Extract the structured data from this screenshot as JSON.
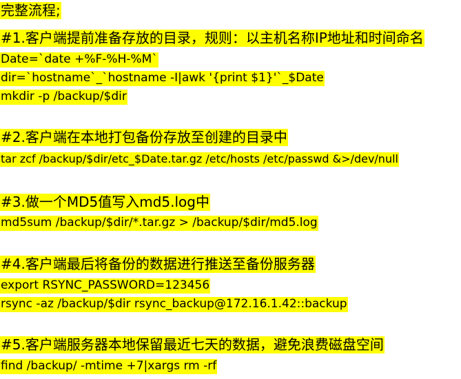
{
  "doc": {
    "title": "完整流程;",
    "sections": [
      {
        "heading": "#1.客户端提前准备存放的目录，规则：以主机名称IP地址和时间命名",
        "commands": [
          "Date=`date +%F-%H-%M`",
          "dir=`hostname`_`hostname -I|awk '{print $1}'`_$Date",
          "mkdir -p /backup/$dir"
        ]
      },
      {
        "heading": "#2.客户端在本地打包备份存放至创建的目录中",
        "commands": [
          "tar zcf /backup/$dir/etc_$Date.tar.gz /etc/hosts /etc/passwd &>/dev/null"
        ]
      },
      {
        "heading": "#3.做一个MD5值写入md5.log中",
        "commands": [
          "md5sum /backup/$dir/*.tar.gz > /backup/$dir/md5.log"
        ]
      },
      {
        "heading": "#4.客户端最后将备份的数据进行推送至备份服务器",
        "commands": [
          "export RSYNC_PASSWORD=123456",
          "rsync -az /backup/$dir rsync_backup@172.16.1.42::backup"
        ]
      },
      {
        "heading": "#5.客户端服务器本地保留最近七天的数据，避免浪费磁盘空间",
        "commands": [
          "find /backup/ -mtime +7|xargs rm -rf"
        ]
      }
    ]
  },
  "colors": {
    "highlight": "#ffff00",
    "text": "#000000",
    "background": "#ffffff"
  }
}
